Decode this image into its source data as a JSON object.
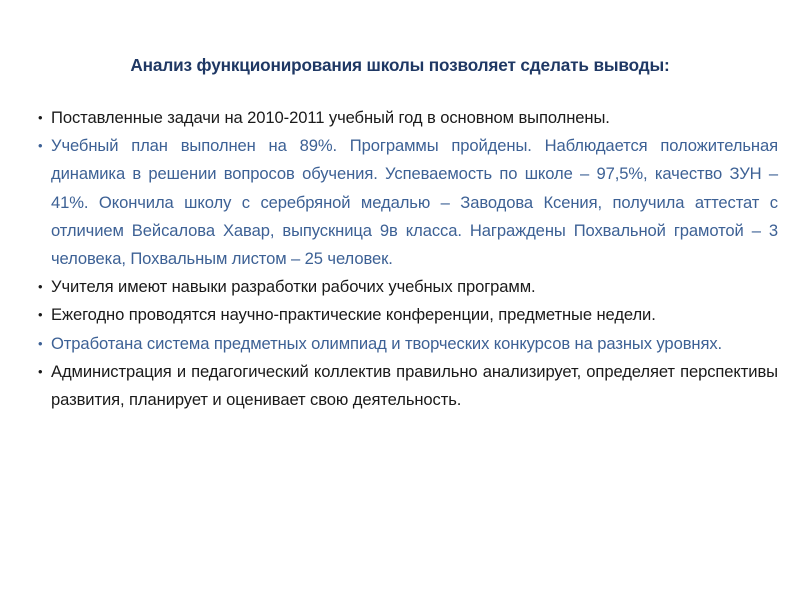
{
  "slide": {
    "background_color": "#FFFFFF",
    "title": "Анализ функционирования школы позволяет сделать выводы:",
    "title_color": "#1F3864",
    "colors": {
      "black": "#1A1A1A",
      "steel_blue": "#3D6195",
      "navy": "#1F3864"
    },
    "bullet_glyph": "•",
    "bullets": [
      {
        "id": "bullet-tasks",
        "color": "#1A1A1A",
        "text": "Поставленные задачи на 2010-2011 учебный год в основном выполнены."
      },
      {
        "id": "bullet-curriculum",
        "color": "#3D6195",
        "text": "Учебный план выполнен на 89%. Программы пройдены. Наблюдается положительная динамика в решении вопросов обучения. Успеваемость по школе – 97,5%, качество ЗУН – 41%. Окончила школу с серебряной медалью – Заводова Ксения, получила аттестат с отличием Вейсалова Хавар, выпускница 9в класса. Награждены Похвальной грамотой – 3 человека, Похвальным листом – 25 человек."
      },
      {
        "id": "bullet-teachers-skills",
        "color": "#1A1A1A",
        "text": "Учителя имеют навыки разработки рабочих учебных программ."
      },
      {
        "id": "bullet-conferences",
        "color": "#1A1A1A",
        "text": "Ежегодно проводятся научно-практические конференции, предметные недели."
      },
      {
        "id": "bullet-olympiads",
        "color": "#3D6195",
        "text": "Отработана система предметных олимпиад и творческих конкурсов на разных уровнях."
      },
      {
        "id": "bullet-administration",
        "color": "#1A1A1A",
        "text": "Администрация и педагогический коллектив правильно анализирует, определяет перспективы развития, планирует и оценивает свою деятельность."
      }
    ]
  }
}
